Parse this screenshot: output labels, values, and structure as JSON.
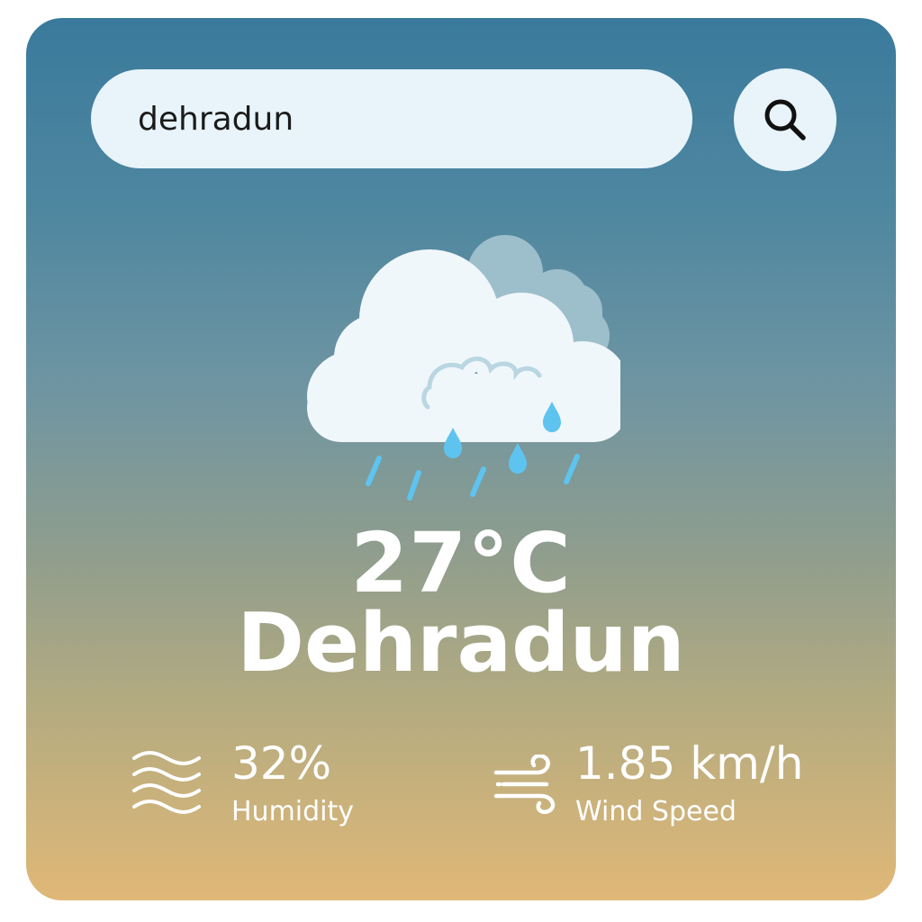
{
  "search": {
    "value": "dehradun",
    "button_icon": "search-icon"
  },
  "weather": {
    "condition_icon": "rain-cloud-icon",
    "temperature": "27°C",
    "city": "Dehradun"
  },
  "stats": {
    "humidity": {
      "value": "32%",
      "label": "Humidity",
      "icon": "humidity-icon"
    },
    "wind": {
      "value": "1.85 km/h",
      "label": "Wind Speed",
      "icon": "wind-icon"
    }
  },
  "colors": {
    "gradient_top": "#3a7a9c",
    "gradient_bottom": "#e0b877",
    "search_background": "#e8f4fa",
    "text": "#ffffff",
    "raindrop": "#5ec4ef"
  }
}
